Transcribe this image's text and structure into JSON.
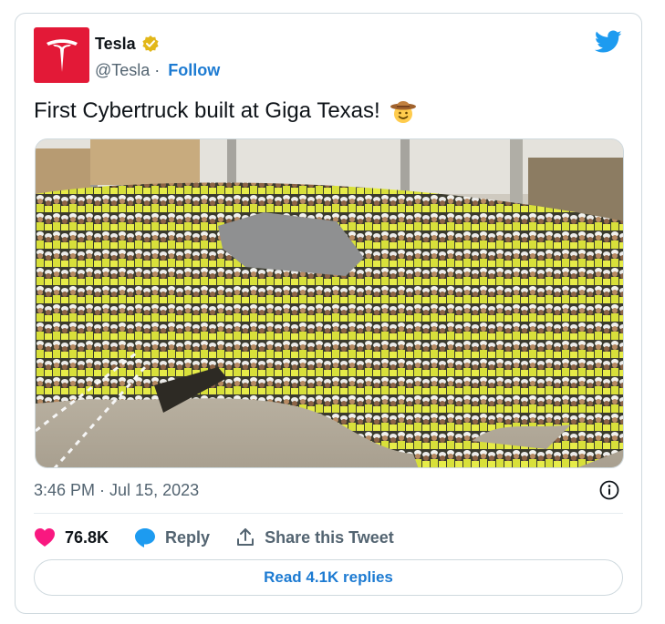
{
  "author": {
    "name": "Tesla",
    "handle": "@Tesla",
    "separator": "·",
    "follow_label": "Follow",
    "verified": true,
    "avatar_color": "#e31937"
  },
  "tweet": {
    "text": "First Cybertruck built at Giga Texas!",
    "emoji": "cowboy-hat-face",
    "timestamp": "3:46 PM · Jul 15, 2023"
  },
  "actions": {
    "like_count": "76.8K",
    "reply_label": "Reply",
    "share_label": "Share this Tweet"
  },
  "read_replies_label": "Read 4.1K replies",
  "colors": {
    "accent": "#1d7bd2",
    "like": "#f91880",
    "twitter_blue": "#1d9bf0",
    "muted": "#536471",
    "border": "#cfd9de"
  },
  "icons": [
    "tesla-logo-icon",
    "verified-badge-icon",
    "twitter-bird-icon",
    "info-icon",
    "heart-icon",
    "reply-bubble-icon",
    "share-icon"
  ]
}
